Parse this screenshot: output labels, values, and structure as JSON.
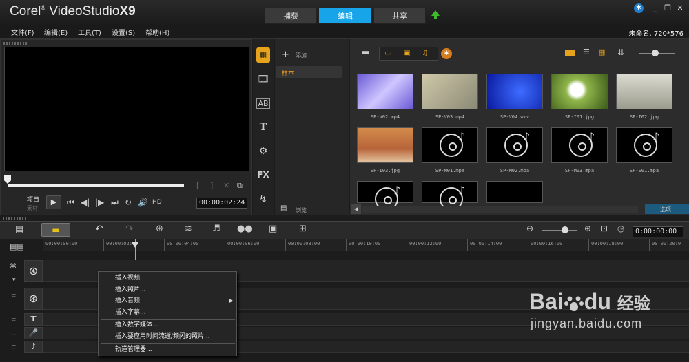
{
  "app": {
    "brand_prefix": "Corel",
    "brand_name": "VideoStudio",
    "brand_version": "X9"
  },
  "tabs": [
    {
      "label": "捕获"
    },
    {
      "label": "编辑"
    },
    {
      "label": "共享"
    }
  ],
  "window_icons": {
    "help": "globe-help-icon",
    "minimize": "_",
    "restore": "❐",
    "close": "✕"
  },
  "menu": [
    {
      "label": "文件(F)"
    },
    {
      "label": "编辑(E)"
    },
    {
      "label": "工具(T)"
    },
    {
      "label": "设置(S)"
    },
    {
      "label": "帮助(H)"
    }
  ],
  "project_info": "未命名, 720*576",
  "preview": {
    "mode_project": "项目",
    "mode_clip": "素材",
    "timecode": "00:00:02:24",
    "hd_label": "HD"
  },
  "library": {
    "add_label": "添加",
    "folder_label": "样本",
    "browse_label": "浏览",
    "options_label": "选项",
    "items": [
      {
        "name": "SP-V02.mp4",
        "kind": "video-pattern"
      },
      {
        "name": "SP-V03.mp4",
        "kind": "video-plain"
      },
      {
        "name": "SP-V04.wmv",
        "kind": "video-blue"
      },
      {
        "name": "SP-I01.jpg",
        "kind": "image-dandelion"
      },
      {
        "name": "SP-I02.jpg",
        "kind": "image-tree"
      },
      {
        "name": "SP-I03.jpg",
        "kind": "image-desert"
      },
      {
        "name": "SP-M01.mpa",
        "kind": "audio"
      },
      {
        "name": "SP-M02.mpa",
        "kind": "audio"
      },
      {
        "name": "SP-M03.mpa",
        "kind": "audio"
      },
      {
        "name": "SP-S01.mpa",
        "kind": "audio"
      },
      {
        "name": "",
        "kind": "audio"
      },
      {
        "name": "",
        "kind": "audio"
      },
      {
        "name": "",
        "kind": "video-black"
      }
    ]
  },
  "timeline": {
    "timecode": "0:00:00:00",
    "ruler": [
      "00:00:00:00",
      "00:00:02:00",
      "00:00:04:00",
      "00:00:06:00",
      "00:00:08:00",
      "00:00:10:00",
      "00:00:12:00",
      "00:00:14:00",
      "00:00:16:00",
      "00:00:18:00",
      "00:00:20:0"
    ]
  },
  "context_menu": {
    "items": [
      {
        "label": "插入视频..."
      },
      {
        "label": "插入照片..."
      },
      {
        "label": "插入音频",
        "submenu": true
      },
      {
        "label": "插入字幕..."
      },
      {
        "label": "插入数字媒体..."
      },
      {
        "label": "插入要应用时间流逝/频闪的照片..."
      },
      {
        "label": "轨道管理器..."
      }
    ]
  },
  "watermark": {
    "brand": "Bai",
    "brand2": "du",
    "cn": "经验",
    "url": "jingyan.baidu.com"
  }
}
